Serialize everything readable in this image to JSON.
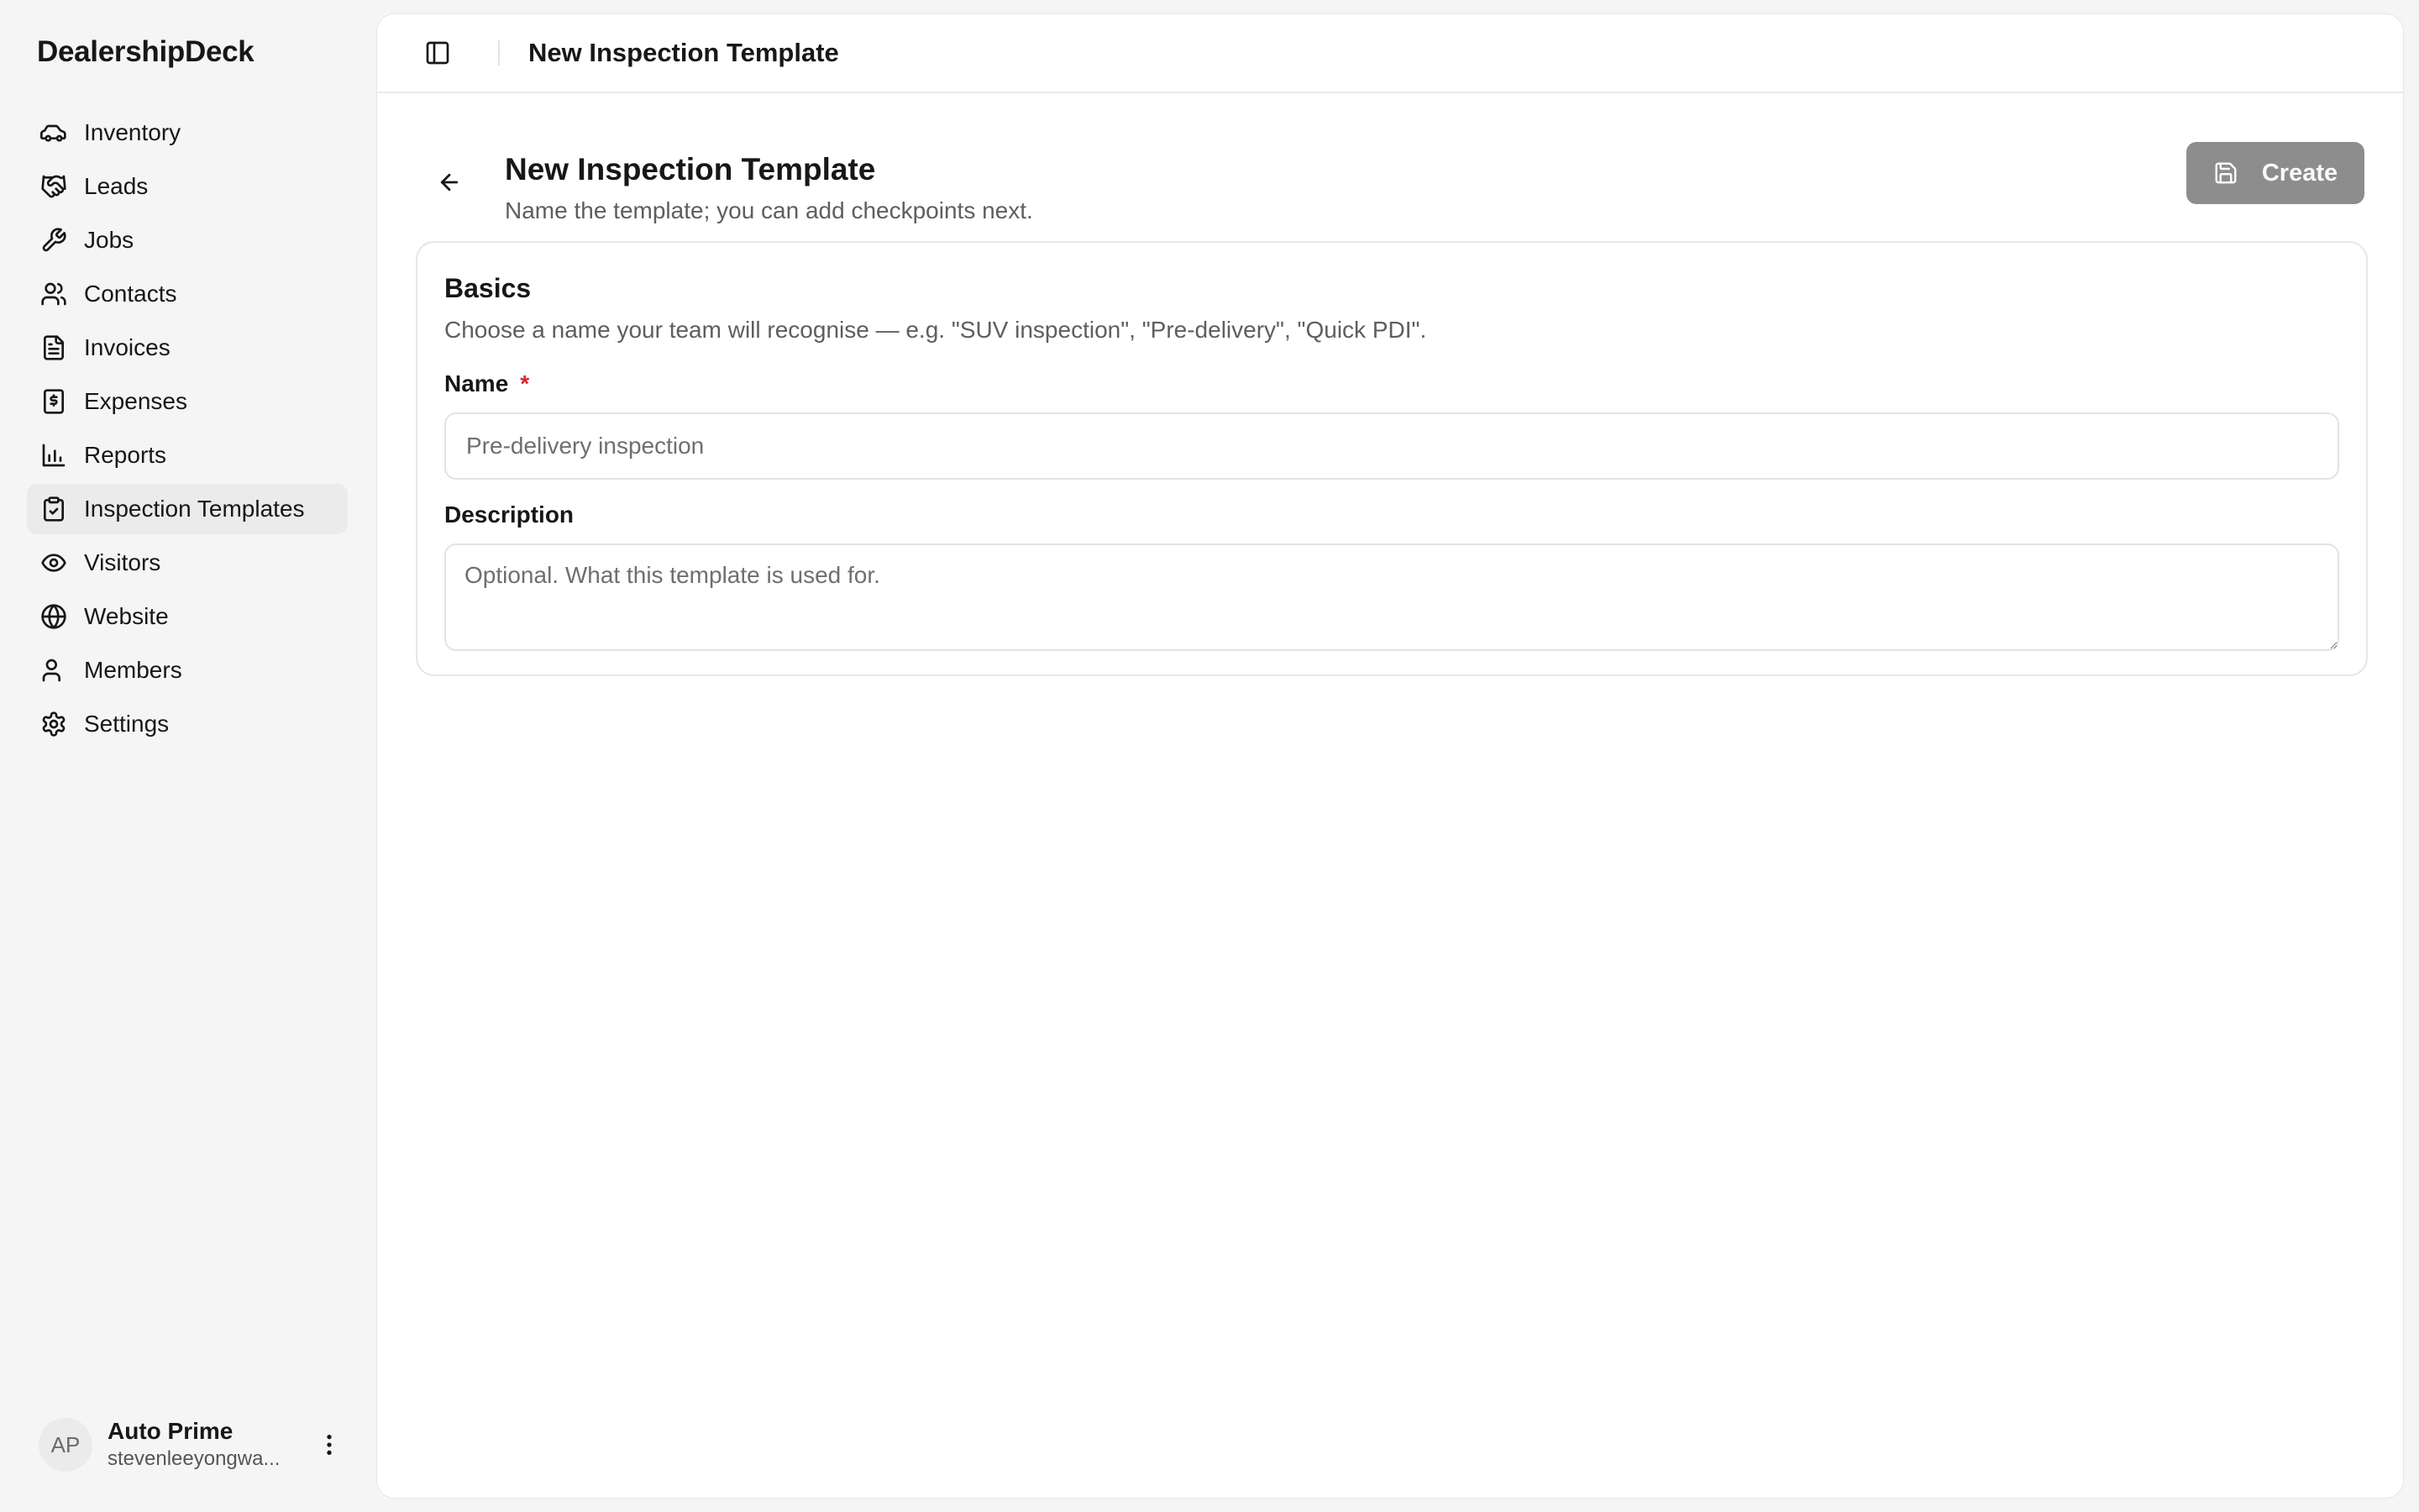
{
  "app": {
    "name": "DealershipDeck"
  },
  "sidebar": {
    "items": [
      {
        "label": "Inventory",
        "icon": "car-icon"
      },
      {
        "label": "Leads",
        "icon": "handshake-icon"
      },
      {
        "label": "Jobs",
        "icon": "wrench-icon"
      },
      {
        "label": "Contacts",
        "icon": "users-icon"
      },
      {
        "label": "Invoices",
        "icon": "file-text-icon"
      },
      {
        "label": "Expenses",
        "icon": "receipt-icon"
      },
      {
        "label": "Reports",
        "icon": "bar-chart-icon"
      },
      {
        "label": "Inspection Templates",
        "icon": "clipboard-check-icon",
        "active": true
      },
      {
        "label": "Visitors",
        "icon": "eye-icon"
      },
      {
        "label": "Website",
        "icon": "globe-icon"
      },
      {
        "label": "Members",
        "icon": "user-icon"
      },
      {
        "label": "Settings",
        "icon": "gear-icon"
      }
    ],
    "user": {
      "initials": "AP",
      "name": "Auto Prime",
      "email": "stevenleeyongwa..."
    }
  },
  "topbar": {
    "title": "New Inspection Template"
  },
  "page": {
    "title": "New Inspection Template",
    "subtitle": "Name the template; you can add checkpoints next.",
    "create_label": "Create"
  },
  "card": {
    "title": "Basics",
    "description": "Choose a name your team will recognise — e.g. \"SUV inspection\", \"Pre-delivery\", \"Quick PDI\".",
    "name_label": "Name",
    "required_mark": "*",
    "name_placeholder": "Pre-delivery inspection",
    "name_value": "",
    "description_label": "Description",
    "description_placeholder": "Optional. What this template is used for.",
    "description_value": ""
  },
  "colors": {
    "background": "#f5f5f5",
    "panel": "#ffffff",
    "active_nav": "#ebebeb",
    "create_button": "#8d8d8d",
    "required": "#dc2626"
  }
}
